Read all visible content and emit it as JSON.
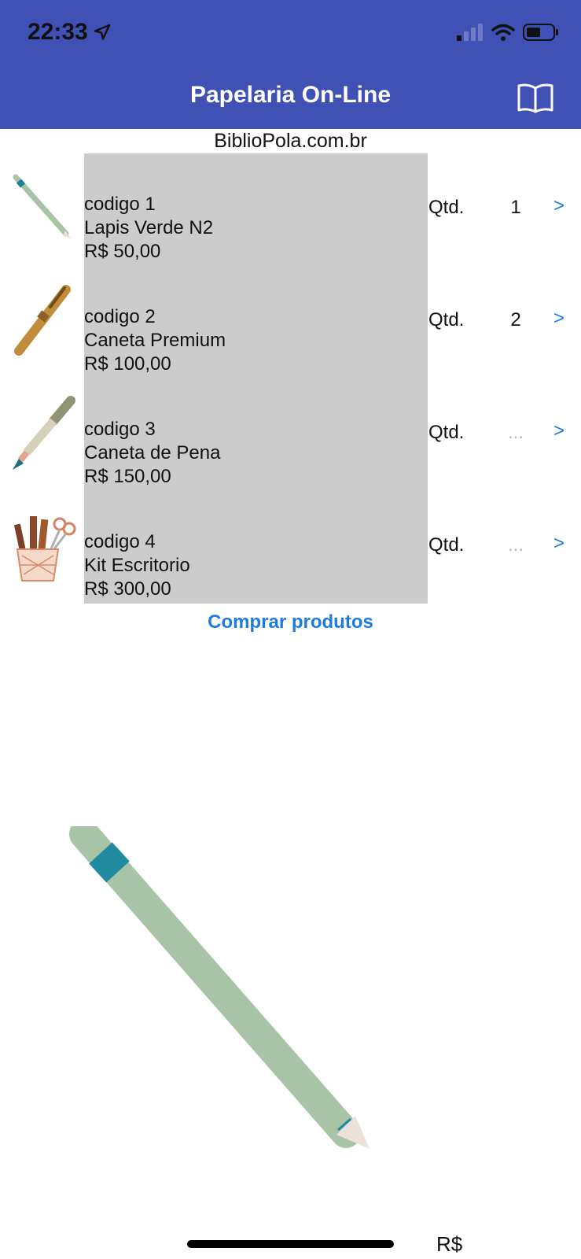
{
  "status_bar": {
    "time": "22:33",
    "icons": [
      "location-arrow-icon",
      "cellular-signal-icon",
      "wifi-icon",
      "battery-icon"
    ]
  },
  "header": {
    "title": "Papelaria On-Line",
    "action_icon": "book-icon",
    "background_color": "#3f51b5"
  },
  "site_label": "BiblioPola.com.br",
  "products": [
    {
      "code": "codigo 1",
      "name": "Lapis Verde N2",
      "price": "R$ 50,00",
      "qty_label": "Qtd.",
      "qty": "1",
      "chevron": ">",
      "icon": "green-pencil-icon"
    },
    {
      "code": "codigo 2",
      "name": "Caneta Premium",
      "price": "R$ 100,00",
      "qty_label": "Qtd.",
      "qty": "2",
      "chevron": ">",
      "icon": "premium-pen-icon"
    },
    {
      "code": "codigo 3",
      "name": "Caneta de Pena",
      "price": "R$ 150,00",
      "qty_label": "Qtd.",
      "qty": "...",
      "chevron": ">",
      "icon": "fountain-pen-icon"
    },
    {
      "code": "codigo 4",
      "name": "Kit Escritorio",
      "price": "R$ 300,00",
      "qty_label": "Qtd.",
      "qty": "...",
      "chevron": ">",
      "icon": "office-kit-icon"
    }
  ],
  "buy_button": "Comprar produtos",
  "preview_image": "green-pencil-large-image",
  "total_currency": "R$",
  "colors": {
    "accent": "#1e7be0",
    "list_background": "#cccccc",
    "placeholder": "#b9b9b9"
  }
}
